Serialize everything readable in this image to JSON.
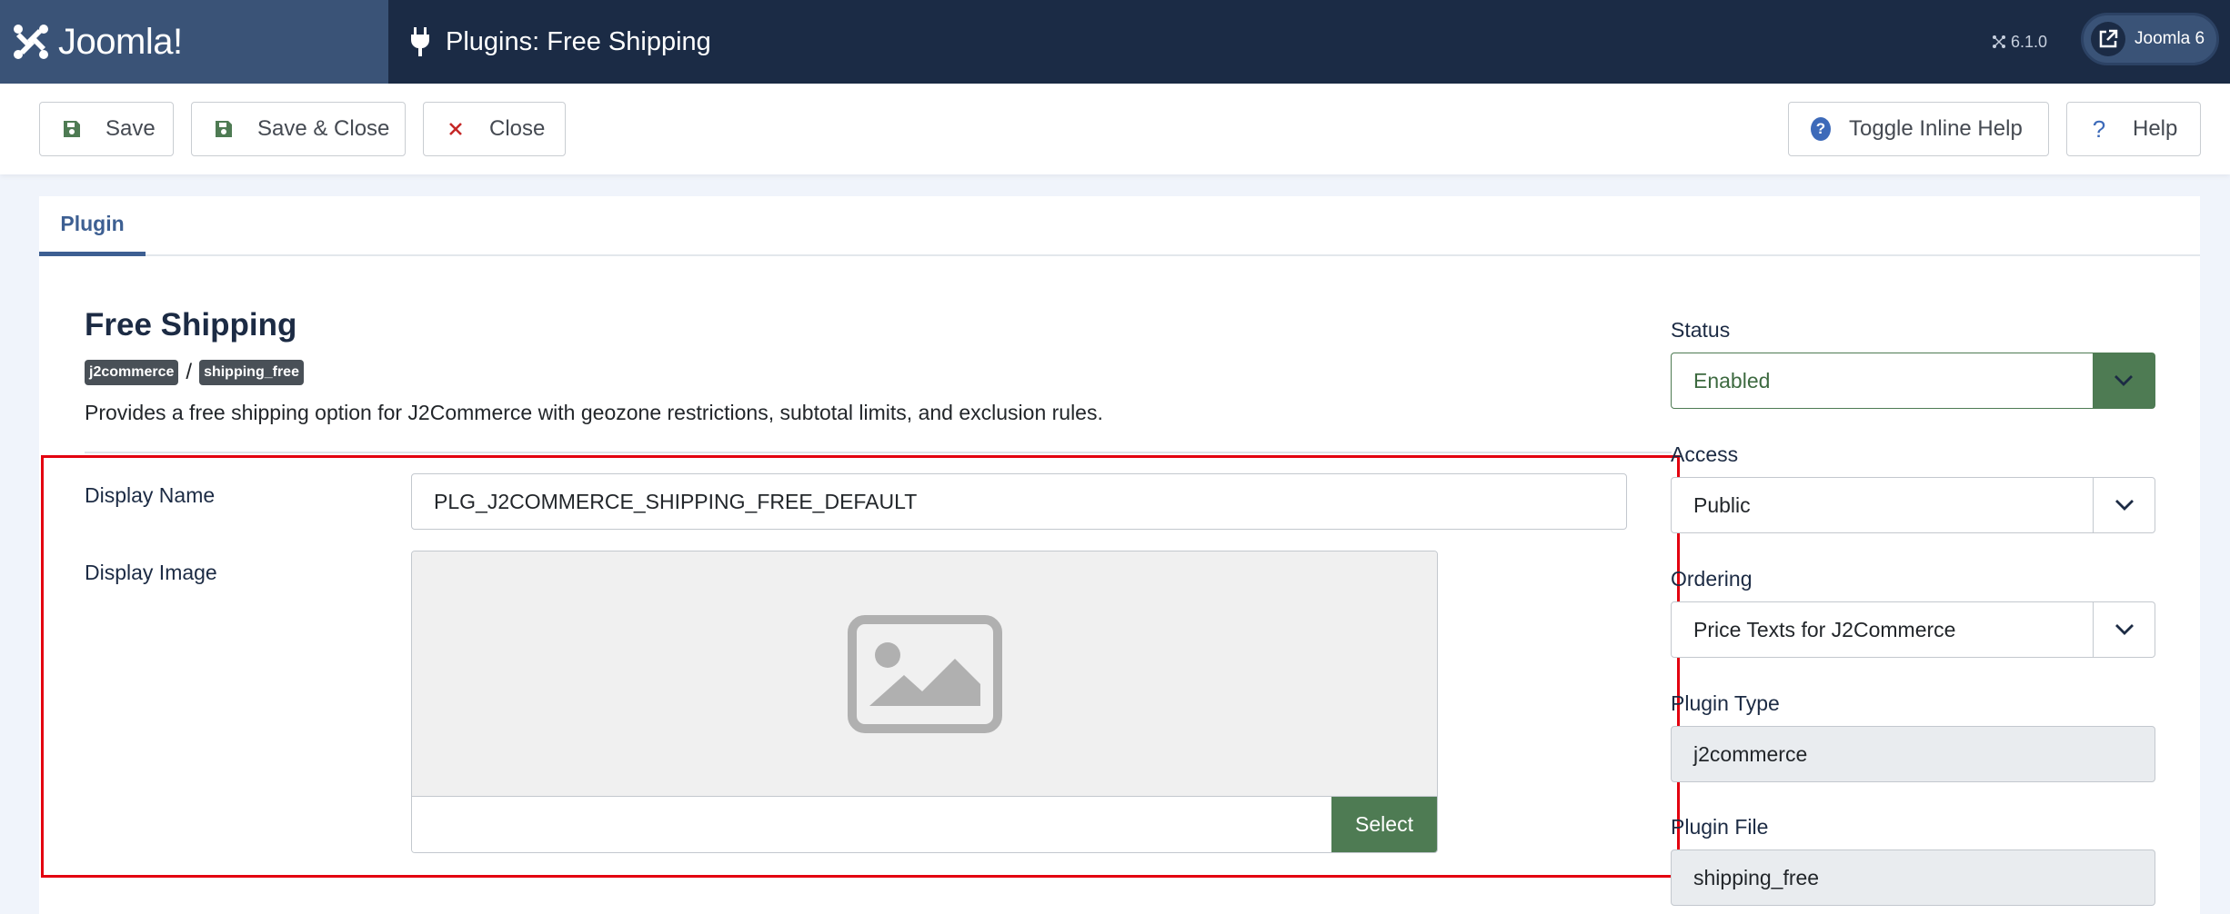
{
  "header": {
    "brand_name": "Joomla!",
    "title": "Plugins: Free Shipping",
    "version": "6.1.0",
    "site_link_label": "Joomla 6",
    "colors": {
      "bar": "#1b2b45",
      "brand": "#3a5377"
    }
  },
  "toolbar": {
    "save_label": "Save",
    "save_close_label": "Save & Close",
    "close_label": "Close",
    "toggle_inline_help_label": "Toggle Inline Help",
    "help_label": "Help",
    "help_glyph": "?"
  },
  "tabs": [
    {
      "label": "Plugin",
      "active": true
    }
  ],
  "plugin": {
    "title": "Free Shipping",
    "group_badge": "j2commerce",
    "separator": "/",
    "element_badge": "shipping_free",
    "description": "Provides a free shipping option for J2Commerce with geozone restrictions, subtotal limits, and exclusion rules."
  },
  "form": {
    "display_name_label": "Display Name",
    "display_name_value": "PLG_J2COMMERCE_SHIPPING_FREE_DEFAULT",
    "display_image_label": "Display Image",
    "display_image_value": "",
    "select_button_label": "Select"
  },
  "sidebar": {
    "status_label": "Status",
    "status_value": "Enabled",
    "access_label": "Access",
    "access_value": "Public",
    "ordering_label": "Ordering",
    "ordering_value": "Price Texts for J2Commerce",
    "plugin_type_label": "Plugin Type",
    "plugin_type_value": "j2commerce",
    "plugin_file_label": "Plugin File",
    "plugin_file_value": "shipping_free"
  },
  "icons": {
    "brand": "joomla-logo-icon",
    "plug": "plug-icon",
    "save": "floppy-disk-icon",
    "close": "x-icon",
    "help": "question-circle-icon",
    "external": "external-link-icon",
    "image_placeholder": "image-placeholder-icon",
    "caret": "chevron-down-icon"
  },
  "colors": {
    "success": "#4e7b53",
    "highlight": "#e3000f",
    "danger": "#c52827",
    "help": "#3d6ab9",
    "tab_active": "#3d5f92"
  }
}
